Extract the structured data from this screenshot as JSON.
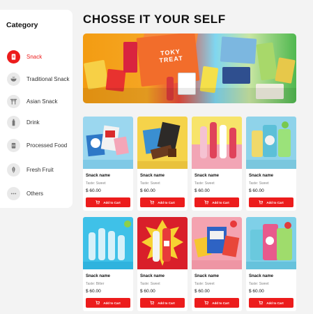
{
  "sidebar": {
    "title": "Category",
    "items": [
      {
        "label": "Snack",
        "icon": "snack-icon",
        "active": true
      },
      {
        "label": "Traditional Snack",
        "icon": "bowl-icon",
        "active": false
      },
      {
        "label": "Asian Snack",
        "icon": "torii-gate-icon",
        "active": false
      },
      {
        "label": "Drink",
        "icon": "bottle-icon",
        "active": false
      },
      {
        "label": "Processed Food",
        "icon": "can-icon",
        "active": false
      },
      {
        "label": "Fresh Fruit",
        "icon": "leaf-icon",
        "active": false
      },
      {
        "label": "Others",
        "icon": "more-dots-icon",
        "active": false
      }
    ]
  },
  "header": {
    "title": "CHOSSE IT YOUR SELF"
  },
  "banner": {
    "box_text": "TOKY TREAT"
  },
  "products": [
    {
      "name": "Snack name",
      "taste": "Taste: Sweet",
      "price": "$ 60.00",
      "button": "Add to Cart"
    },
    {
      "name": "Snack name",
      "taste": "Taste: Sweet",
      "price": "$ 60.00",
      "button": "Add to Cart"
    },
    {
      "name": "Snack name",
      "taste": "Taste: Sweet",
      "price": "$ 60.00",
      "button": "Add to Cart"
    },
    {
      "name": "Snack name",
      "taste": "Taste: Sweet",
      "price": "$ 60.00",
      "button": "Add to Cart"
    },
    {
      "name": "Snack name",
      "taste": "Taste: Bitter",
      "price": "$ 60.00",
      "button": "Add to Cart"
    },
    {
      "name": "Snack name",
      "taste": "Taste: Sweet",
      "price": "$ 60.00",
      "button": "Add to Cart"
    },
    {
      "name": "Snack name",
      "taste": "Taste: Sweet",
      "price": "$ 60.00",
      "button": "Add to Cart"
    },
    {
      "name": "Snack name",
      "taste": "Taste: Sweet",
      "price": "$ 60.00",
      "button": "Add to Cart"
    }
  ],
  "colors": {
    "accent": "#ec1c1c",
    "background": "#f3f3f3"
  }
}
